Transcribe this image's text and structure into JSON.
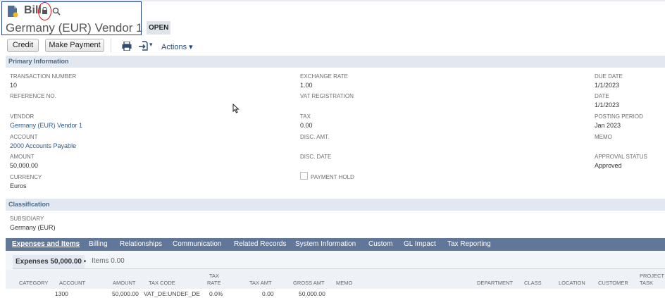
{
  "record": {
    "type": "Bill",
    "name": "Germany (EUR) Vendor 1",
    "status": "OPEN"
  },
  "toolbar": {
    "credit_label": "Credit",
    "make_payment_label": "Make Payment",
    "actions_label": "Actions",
    "actions_caret": "▾",
    "export_caret": "▾"
  },
  "primary": {
    "title": "Primary Information",
    "transaction_number": {
      "label": "TRANSACTION NUMBER",
      "value": "10"
    },
    "reference_no": {
      "label": "REFERENCE NO.",
      "value": ""
    },
    "vendor": {
      "label": "VENDOR",
      "value": "Germany (EUR) Vendor 1"
    },
    "account": {
      "label": "ACCOUNT",
      "value": "2000 Accounts Payable"
    },
    "amount": {
      "label": "AMOUNT",
      "value": "50,000.00"
    },
    "currency": {
      "label": "CURRENCY",
      "value": "Euros"
    },
    "exchange_rate": {
      "label": "EXCHANGE RATE",
      "value": "1.00"
    },
    "vat_registration": {
      "label": "VAT REGISTRATION",
      "value": ""
    },
    "tax": {
      "label": "TAX",
      "value": "0.00"
    },
    "disc_amt": {
      "label": "DISC. AMT.",
      "value": ""
    },
    "disc_date": {
      "label": "DISC. DATE",
      "value": ""
    },
    "payment_hold": {
      "label": "PAYMENT HOLD",
      "checked": false
    },
    "due_date": {
      "label": "DUE DATE",
      "value": "1/1/2023"
    },
    "date": {
      "label": "DATE",
      "value": "1/1/2023"
    },
    "posting_period": {
      "label": "POSTING PERIOD",
      "value": "Jan 2023"
    },
    "memo": {
      "label": "MEMO",
      "value": ""
    },
    "approval_status": {
      "label": "APPROVAL STATUS",
      "value": "Approved"
    }
  },
  "classification": {
    "title": "Classification",
    "subsidiary": {
      "label": "SUBSIDIARY",
      "value": "Germany (EUR)"
    }
  },
  "subtabs": [
    "Expenses and Items",
    "Billing",
    "Relationships",
    "Communication",
    "Related Records",
    "System Information",
    "Custom",
    "GL Impact",
    "Tax Reporting"
  ],
  "inner_tabs": {
    "expenses": "Expenses 50,000.00",
    "expenses_bullet": "•",
    "items": "Items 0.00"
  },
  "columns": {
    "category": "CATEGORY",
    "account": "ACCOUNT",
    "amount": "AMOUNT",
    "tax_code": "TAX CODE",
    "tax_rate_1": "TAX",
    "tax_rate_2": "RATE",
    "tax_amt": "TAX AMT",
    "gross_amt": "GROSS AMT",
    "memo": "MEMO",
    "department": "DEPARTMENT",
    "class": "CLASS",
    "location": "LOCATION",
    "customer": "CUSTOMER",
    "project_task_1": "PROJECT",
    "project_task_2": "TASK"
  },
  "rows": [
    {
      "account": "1300",
      "amount": "50,000.00",
      "tax_code": "VAT_DE:UNDEF_DE",
      "tax_rate": "0.0%",
      "tax_amt": "0.00",
      "gross_amt": "50,000.00"
    }
  ],
  "icons": {
    "record": "bill-document-icon",
    "lock": "lock-icon",
    "search": "search-icon",
    "print": "print-icon",
    "export": "export-icon",
    "cursor": "mouse-cursor-icon"
  },
  "colors": {
    "section_bar": "#e1e8ef",
    "subtab_bar": "#607799",
    "link": "#2a5a8c",
    "highlight_box": "#1f3f9a",
    "highlight_circle": "#dd1111"
  }
}
